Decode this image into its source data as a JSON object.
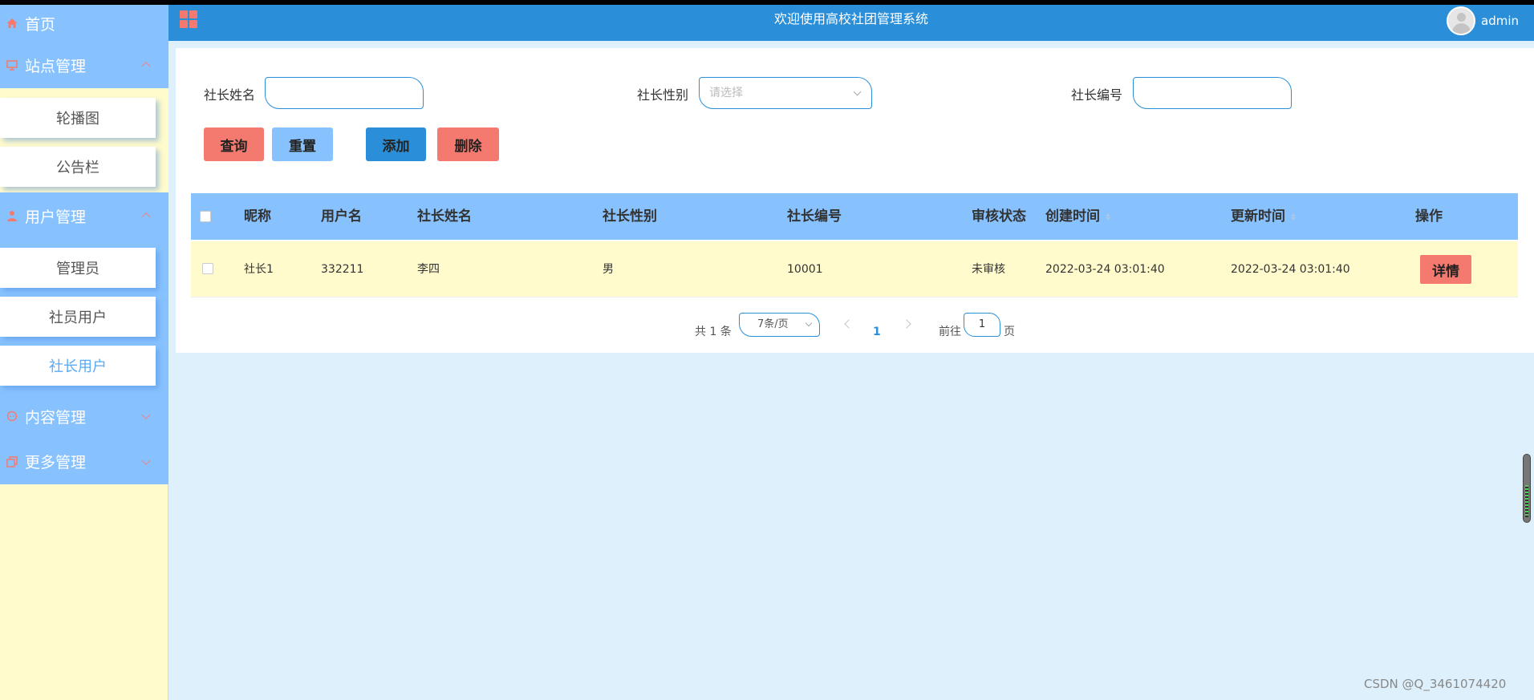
{
  "colors": {
    "header_bg": "#2a8fd8",
    "sidebar_bg": "#fffbcc",
    "menu_bg": "#87c2ff",
    "accent_red": "#f47a6f",
    "accent_blue": "#2a8fd8",
    "page_bg": "#dff0fd"
  },
  "header": {
    "title": "欢迎使用高校社团管理系统",
    "menu_icon": "grid-icon",
    "user_name": "admin"
  },
  "sidebar": {
    "home": {
      "label": "首页",
      "icon": "home-icon"
    },
    "groups": [
      {
        "label": "站点管理",
        "icon": "monitor-icon",
        "expanded": true,
        "items": [
          "轮播图",
          "公告栏"
        ]
      },
      {
        "label": "用户管理",
        "icon": "user-icon",
        "expanded": true,
        "items": [
          "管理员",
          "社员用户",
          "社长用户"
        ],
        "active_item": "社长用户"
      },
      {
        "label": "内容管理",
        "icon": "chat-icon",
        "expanded": false,
        "items": []
      },
      {
        "label": "更多管理",
        "icon": "copy-icon",
        "expanded": false,
        "items": []
      }
    ]
  },
  "filters": {
    "name_label": "社长姓名",
    "name_value": "",
    "gender_label": "社长性别",
    "gender_placeholder": "请选择",
    "number_label": "社长编号",
    "number_value": ""
  },
  "buttons": {
    "query": "查询",
    "reset": "重置",
    "add": "添加",
    "delete": "删除"
  },
  "table": {
    "columns": [
      "昵称",
      "用户名",
      "社长姓名",
      "社长性别",
      "社长编号",
      "审核状态",
      "创建时间",
      "更新时间",
      "操作"
    ],
    "rows": [
      {
        "nickname": "社长1",
        "username": "332211",
        "name": "李四",
        "gender": "男",
        "number": "10001",
        "status": "未审核",
        "created": "2022-03-24 03:01:40",
        "updated": "2022-03-24 03:01:40",
        "action": "详情"
      }
    ]
  },
  "pagination": {
    "total_text": "共 1 条",
    "page_size": "7条/页",
    "current_page": "1",
    "goto_label": "前往",
    "goto_value": "1",
    "page_suffix": "页"
  },
  "watermark": "CSDN @Q_3461074420"
}
